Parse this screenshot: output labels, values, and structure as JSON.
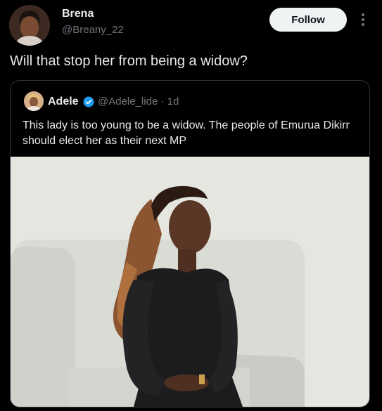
{
  "author": {
    "name": "Brena",
    "handle": "@Breany_22",
    "follow_label": "Follow",
    "more_icon": "more-vertical-icon"
  },
  "post": {
    "text": "Will that stop her from being a widow?"
  },
  "quoted_post": {
    "name": "Adele",
    "verified_icon": "verified-badge-icon",
    "handle": "@Adele_lide",
    "separator": "·",
    "time": "1d",
    "text": "This lady is too young to be a widow. The people of Emurua Dikirr should elect her as their next MP",
    "accent_color": "#1d9bf0"
  },
  "colors": {
    "background": "#000000",
    "text_primary": "#e7e9ea",
    "text_secondary": "#71767b",
    "border": "#2f3336",
    "follow_button_bg": "#eff3f4"
  }
}
